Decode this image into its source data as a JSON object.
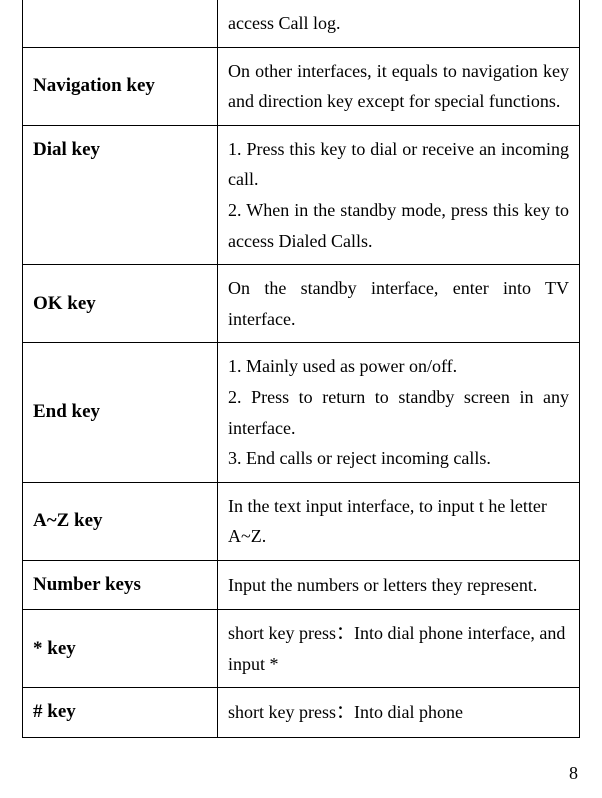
{
  "rows": [
    {
      "label": "",
      "desc": "access Call log."
    },
    {
      "label": "Navigation key",
      "desc": "On other interfaces, it equals to navigation key and direction key except for special functions."
    },
    {
      "label": "Dial key",
      "desc": "1. Press this key to dial or receive an incoming call.\n2. When in the standby mode, press this key to access Dialed Calls."
    },
    {
      "label": "OK key",
      "desc": "On the standby interface, enter into TV interface."
    },
    {
      "label": "End key",
      "desc": "1. Mainly used as power on/off.\n2. Press to return to standby screen in any interface.\n3. End calls or reject incoming calls."
    },
    {
      "label": "A~Z key",
      "desc": "In the text input interface, to input t he letter A~Z."
    },
    {
      "label": "Number keys",
      "desc": "Input the numbers or letters they represent."
    },
    {
      "label": "* key",
      "desc": "short key press：Into dial phone interface, and input *"
    },
    {
      "label": "# key",
      "desc": "short key press：Into dial phone"
    }
  ],
  "page_number": "8"
}
